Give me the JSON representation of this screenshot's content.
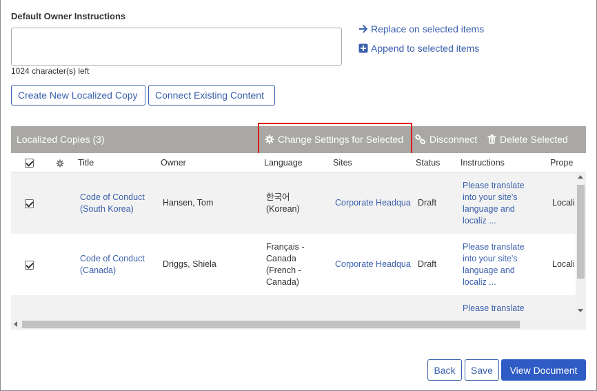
{
  "form": {
    "heading": "Default Owner Instructions",
    "instructions_value": "",
    "chars_left": "1024 character(s) left",
    "replace_link": "Replace on selected items",
    "append_link": "Append to selected items",
    "create_button": "Create New Localized Copy",
    "connect_button": "Connect Existing Content"
  },
  "grid": {
    "title": "Localized Copies (3)",
    "toolbar": {
      "change_settings": "Change Settings for Selected",
      "disconnect": "Disconnect",
      "delete_selected": "Delete Selected"
    },
    "columns": {
      "title": "Title",
      "owner": "Owner",
      "language": "Language",
      "sites": "Sites",
      "status": "Status",
      "instructions": "Instructions",
      "properties": "Prope"
    },
    "rows": [
      {
        "title_l1": "Code of Conduct",
        "title_l2": "(South Korea)",
        "owner": "Hansen, Tom",
        "lang_l1": "한국어",
        "lang_l2": "(Korean)",
        "lang_l3": "",
        "lang_l4": "",
        "sites": "Corporate Headqua",
        "status": "Draft",
        "instr_l1": "Please translate",
        "instr_l2": "into your site's",
        "instr_l3": "language and",
        "instr_l4": "localiz ...",
        "prop": "Locali"
      },
      {
        "title_l1": "Code of Conduct",
        "title_l2": "(Canada)",
        "owner": "Driggs, Shiela",
        "lang_l1": "Français -",
        "lang_l2": "Canada",
        "lang_l3": "(French -",
        "lang_l4": "Canada)",
        "sites": "Corporate Headqua",
        "status": "Draft",
        "instr_l1": "Please translate",
        "instr_l2": "into your site's",
        "instr_l3": "language and",
        "instr_l4": "localiz ...",
        "prop": "Locali"
      },
      {
        "title_l1": "",
        "title_l2": "",
        "owner": "",
        "lang_l1": "",
        "lang_l2": "",
        "lang_l3": "",
        "lang_l4": "",
        "sites": "",
        "status": "",
        "instr_l1": "Please translate",
        "instr_l2": "",
        "instr_l3": "",
        "instr_l4": "",
        "prop": ""
      }
    ]
  },
  "footer": {
    "back": "Back",
    "save": "Save",
    "view_document": "View Document"
  },
  "colors": {
    "accent": "#3a5fad",
    "primary_button": "#2f5cc4",
    "grid_header": "#a9a8a5",
    "highlight": "#e01a1a"
  }
}
